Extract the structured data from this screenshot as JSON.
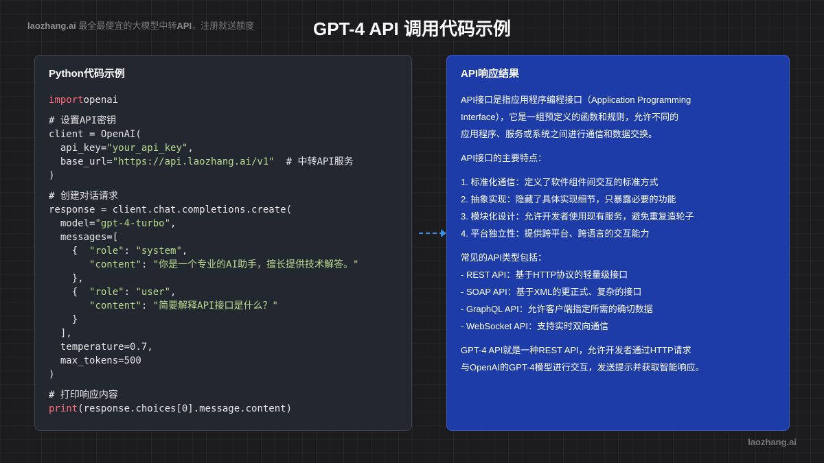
{
  "header": {
    "brand_name": "laozhang.ai",
    "brand_tagline": " 最全最便宜的大模型中转",
    "brand_api": "API",
    "brand_tail": "，注册就送额度",
    "title": "GPT-4 API 调用代码示例"
  },
  "code_panel": {
    "title": "Python代码示例",
    "lines": [
      {
        "segs": [
          {
            "t": "import",
            "c": "kw"
          },
          {
            "t": "openai",
            "c": ""
          }
        ]
      },
      {
        "gap": true
      },
      {
        "segs": [
          {
            "t": "# 设置API密钥",
            "c": "cm"
          }
        ]
      },
      {
        "segs": [
          {
            "t": "client = OpenAI(",
            "c": ""
          }
        ]
      },
      {
        "segs": [
          {
            "t": "  api_key=",
            "c": ""
          },
          {
            "t": "\"your_api_key\"",
            "c": "str"
          },
          {
            "t": ",",
            "c": ""
          }
        ]
      },
      {
        "segs": [
          {
            "t": "  base_url=",
            "c": ""
          },
          {
            "t": "\"https://api.laozhang.ai/v1\"",
            "c": "str"
          },
          {
            "t": "  # 中转API服务",
            "c": "cm"
          }
        ]
      },
      {
        "segs": [
          {
            "t": ")",
            "c": ""
          }
        ]
      },
      {
        "gap": true
      },
      {
        "segs": [
          {
            "t": "# 创建对话请求",
            "c": "cm"
          }
        ]
      },
      {
        "segs": [
          {
            "t": "response = client.chat.completions.create(",
            "c": ""
          }
        ]
      },
      {
        "segs": [
          {
            "t": "  model=",
            "c": ""
          },
          {
            "t": "\"gpt-4-turbo\"",
            "c": "str"
          },
          {
            "t": ",",
            "c": ""
          }
        ]
      },
      {
        "segs": [
          {
            "t": "  messages=[",
            "c": ""
          }
        ]
      },
      {
        "segs": [
          {
            "t": "    {  ",
            "c": ""
          },
          {
            "t": "\"role\"",
            "c": "str"
          },
          {
            "t": ": ",
            "c": ""
          },
          {
            "t": "\"system\"",
            "c": "str"
          },
          {
            "t": ",",
            "c": ""
          }
        ]
      },
      {
        "segs": [
          {
            "t": "       ",
            "c": ""
          },
          {
            "t": "\"content\"",
            "c": "str"
          },
          {
            "t": ": ",
            "c": ""
          },
          {
            "t": "\"你是一个专业的AI助手，擅长提供技术解答。\"",
            "c": "str"
          }
        ]
      },
      {
        "segs": [
          {
            "t": "    },",
            "c": ""
          }
        ]
      },
      {
        "segs": [
          {
            "t": "    {  ",
            "c": ""
          },
          {
            "t": "\"role\"",
            "c": "str"
          },
          {
            "t": ": ",
            "c": ""
          },
          {
            "t": "\"user\"",
            "c": "str"
          },
          {
            "t": ",",
            "c": ""
          }
        ]
      },
      {
        "segs": [
          {
            "t": "       ",
            "c": ""
          },
          {
            "t": "\"content\"",
            "c": "str"
          },
          {
            "t": ": ",
            "c": ""
          },
          {
            "t": "\"简要解释API接口是什么？\"",
            "c": "str"
          }
        ]
      },
      {
        "segs": [
          {
            "t": "    }",
            "c": ""
          }
        ]
      },
      {
        "segs": [
          {
            "t": "  ],",
            "c": ""
          }
        ]
      },
      {
        "segs": [
          {
            "t": "  temperature=0.7,",
            "c": ""
          }
        ]
      },
      {
        "segs": [
          {
            "t": "  max_tokens=500",
            "c": ""
          }
        ]
      },
      {
        "segs": [
          {
            "t": ")",
            "c": ""
          }
        ]
      },
      {
        "gap": true
      },
      {
        "segs": [
          {
            "t": "# 打印响应内容",
            "c": "cm"
          }
        ]
      },
      {
        "segs": [
          {
            "t": "print",
            "c": "kw"
          },
          {
            "t": "(response.choices[0].message.content)",
            "c": ""
          }
        ]
      }
    ]
  },
  "response_panel": {
    "title": "API响应结果",
    "lines": [
      "API接口是指应用程序编程接口（Application Programming",
      "Interface），它是一组预定义的函数和规则，允许不同的",
      "应用程序、服务或系统之间进行通信和数据交换。",
      "",
      "API接口的主要特点：",
      "",
      "1. 标准化通信：定义了软件组件间交互的标准方式",
      "2. 抽象实现：隐藏了具体实现细节，只暴露必要的功能",
      "3. 模块化设计：允许开发者使用现有服务，避免重复造轮子",
      "4. 平台独立性：提供跨平台、跨语言的交互能力",
      "",
      "常见的API类型包括：",
      "- REST API：基于HTTP协议的轻量级接口",
      "- SOAP API：基于XML的更正式、复杂的接口",
      "- GraphQL API：允许客户端指定所需的确切数据",
      "- WebSocket API：支持实时双向通信",
      "",
      "GPT-4 API就是一种REST API，允许开发者通过HTTP请求",
      "与OpenAI的GPT-4模型进行交互，发送提示并获取智能响应。"
    ]
  },
  "footer": {
    "brand": "laozhang.ai"
  },
  "colors": {
    "background": "#1c1c1e",
    "code_panel_bg": "#232730",
    "response_panel_bg": "#1e3ca8",
    "keyword": "#ff6b7a",
    "string": "#b9d98f",
    "connector": "#3d8fe6"
  }
}
